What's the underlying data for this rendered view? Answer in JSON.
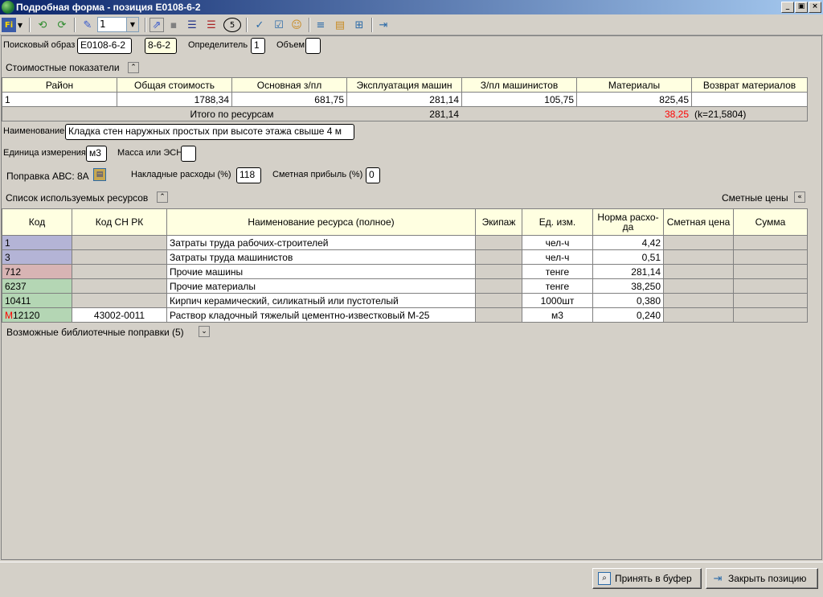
{
  "window": {
    "title": "Подробная форма - позиция Е0108-6-2",
    "min": "_",
    "max": "▣",
    "close": "×"
  },
  "toolbar": {
    "combo_value": "1",
    "circle_label": "5"
  },
  "header": {
    "search_label": "Поисковый образ",
    "search_value": "Е0108-6-2",
    "code_value": "8-6-2",
    "determinant_label": "Определитель",
    "determinant_value": "1",
    "volume_label": "Объем",
    "volume_value": ""
  },
  "cost": {
    "section_title": "Стоимостные показатели",
    "columns": [
      "Район",
      "Общая стоимость",
      "Основная з/пл",
      "Эксплуатация машин",
      "З/пл машинистов",
      "Материалы",
      "Возврат материалов"
    ],
    "row": [
      "1",
      "1788,34",
      "681,75",
      "281,14",
      "105,75",
      "825,45",
      ""
    ],
    "totals_label": "Итого по ресурсам",
    "totals_machines": "281,14",
    "totals_materials": "38,25",
    "totals_k": "(k=21,5804)"
  },
  "details": {
    "name_label": "Наименование",
    "name_value": "Кладка стен наружных простых при высоте этажа свыше 4 м",
    "unit_label": "Единица измерения",
    "unit_value": "м3",
    "mass_label": "Масса или ЭСН",
    "mass_value": "",
    "correction_label": "Поправка АВС: 8А",
    "overhead_label": "Накладные расходы (%)",
    "overhead_value": "118",
    "profit_label": "Сметная прибыль (%)",
    "profit_value": "0"
  },
  "resources": {
    "section_title": "Список используемых ресурсов",
    "prices_label": "Сметные цены",
    "columns": [
      "Код",
      "Код СН РК",
      "Наименование ресурса (полное)",
      "Экипаж",
      "Ед. изм.",
      "Норма расхо-да",
      "Сметная цена",
      "Сумма"
    ],
    "rows": [
      {
        "code": "1",
        "code_prefix": "",
        "snrk": "",
        "name": "Затраты труда рабочих-строителей",
        "crew": "",
        "unit": "чел-ч",
        "norm": "4,42",
        "price": "",
        "sum": "",
        "color": "#b4b4d6"
      },
      {
        "code": "3",
        "code_prefix": "",
        "snrk": "",
        "name": "Затраты труда машинистов",
        "crew": "",
        "unit": "чел-ч",
        "norm": "0,51",
        "price": "",
        "sum": "",
        "color": "#b4b4d6"
      },
      {
        "code": "712",
        "code_prefix": "",
        "snrk": "",
        "name": "Прочие машины",
        "crew": "",
        "unit": "тенге",
        "norm": "281,14",
        "price": "",
        "sum": "",
        "color": "#d8b4b4"
      },
      {
        "code": "6237",
        "code_prefix": "",
        "snrk": "",
        "name": "Прочие материалы",
        "crew": "",
        "unit": "тенге",
        "norm": "38,250",
        "price": "",
        "sum": "",
        "color": "#b4d6b4"
      },
      {
        "code": "10411",
        "code_prefix": "",
        "snrk": "",
        "name": "Кирпич керамический, силикатный или пустотелый",
        "crew": "",
        "unit": "1000шт",
        "norm": "0,380",
        "price": "",
        "sum": "",
        "color": "#b4d6b4"
      },
      {
        "code": "12120",
        "code_prefix": "М",
        "snrk": "43002-0011",
        "name": "Раствор кладочный тяжелый цементно-известковый М-25",
        "crew": "",
        "unit": "м3",
        "norm": "0,240",
        "price": "",
        "sum": "",
        "color": "#b4d6b4"
      }
    ]
  },
  "library": {
    "title": "Возможные библиотечные поправки (5)"
  },
  "buttons": {
    "accept": "Принять в буфер",
    "close": "Закрыть позицию"
  }
}
